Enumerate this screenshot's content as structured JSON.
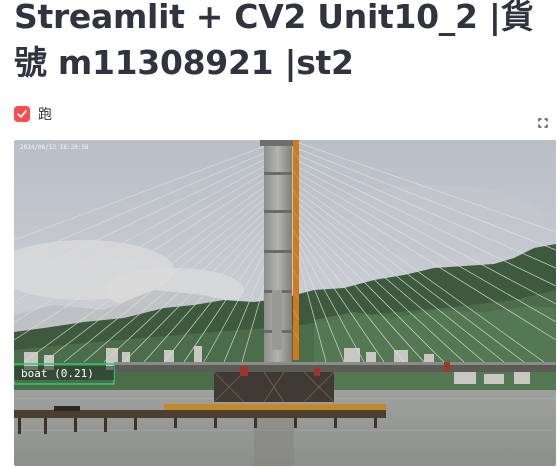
{
  "page": {
    "title": "Streamlit + CV2 Unit10_2 |貨號 m11308921 |st2"
  },
  "controls": {
    "run_checkbox_label": "跑",
    "run_checkbox_checked": true
  },
  "video": {
    "timestamp_overlay": "2024/06/12 16:20:58",
    "detection": {
      "label": "boat (0.21)",
      "box_color": "#2ecc71"
    }
  },
  "colors": {
    "accent": "#ff4b4b",
    "text": "#31333f"
  }
}
